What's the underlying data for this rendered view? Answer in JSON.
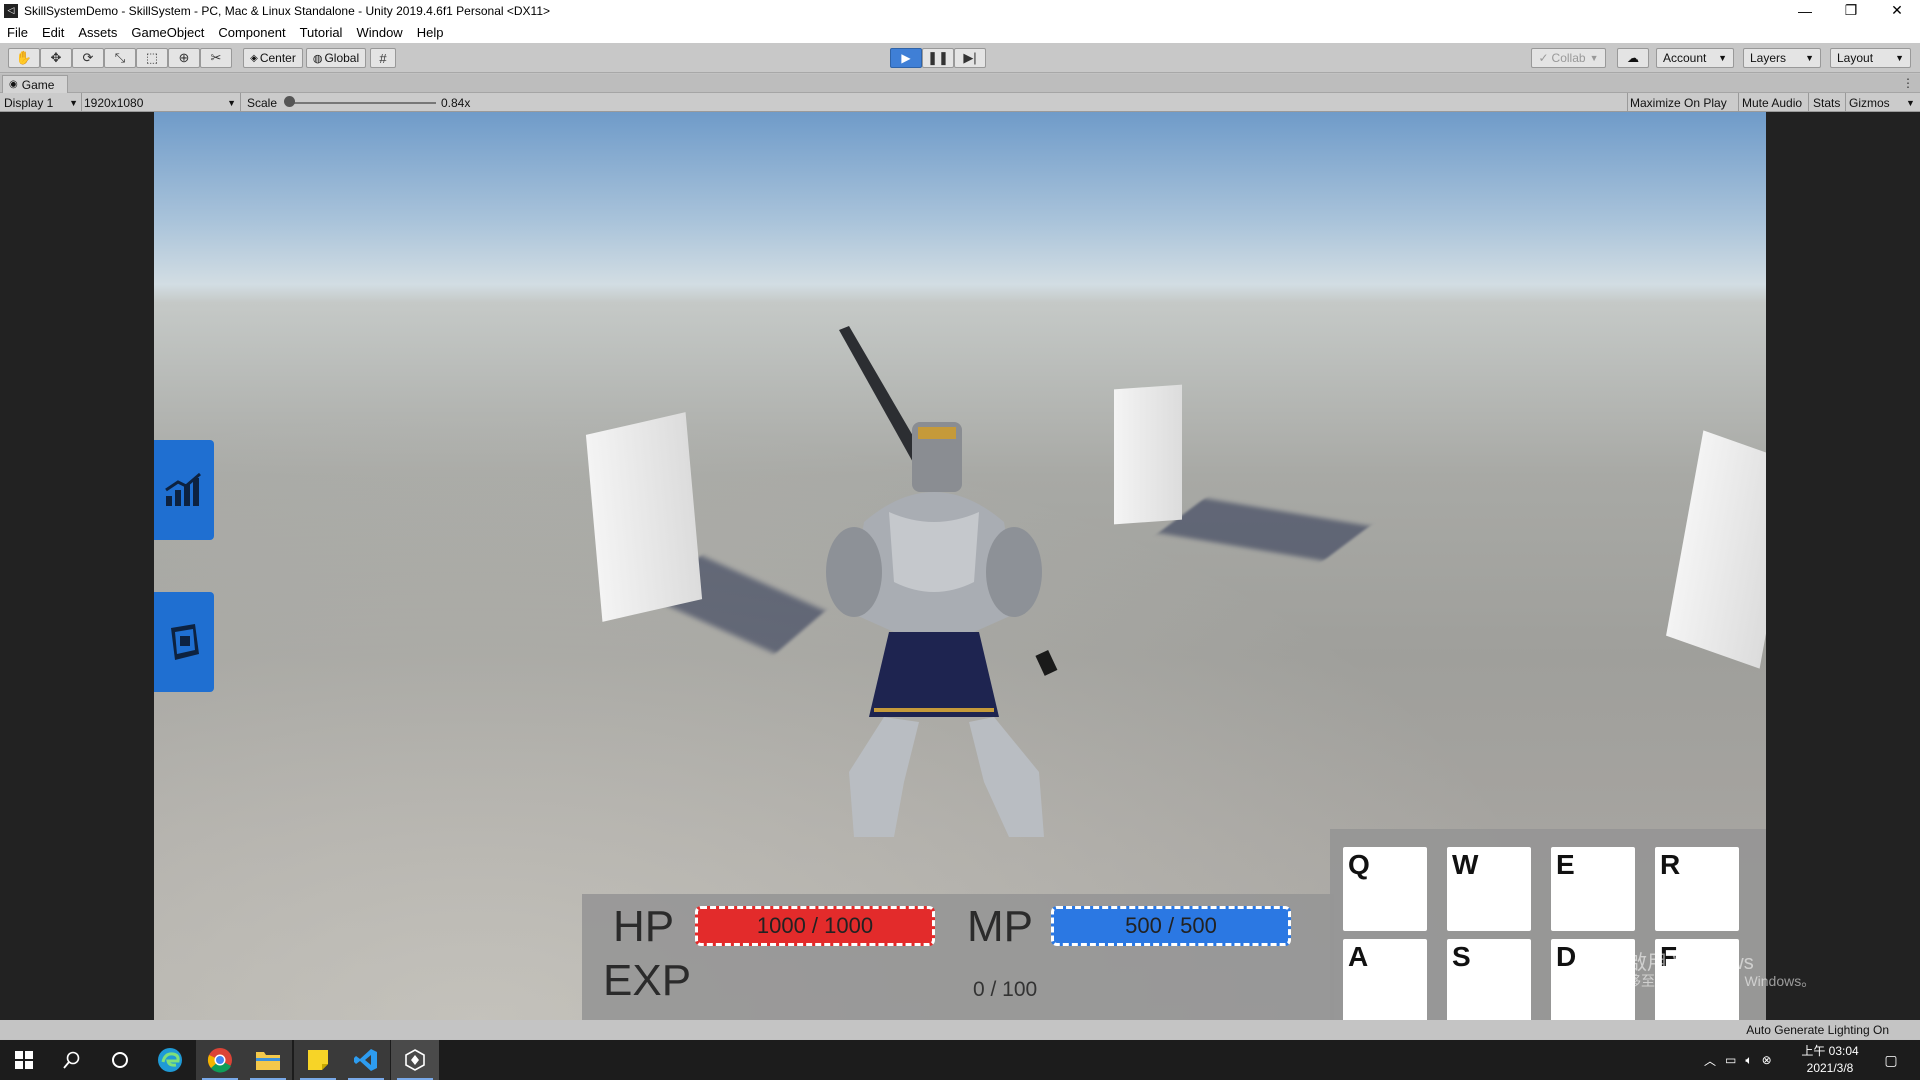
{
  "window": {
    "title": "SkillSystemDemo - SkillSystem - PC, Mac & Linux Standalone - Unity 2019.4.6f1 Personal <DX11>",
    "minimize": "—",
    "restore": "❐",
    "close": "✕"
  },
  "menu": [
    "File",
    "Edit",
    "Assets",
    "GameObject",
    "Component",
    "Tutorial",
    "Window",
    "Help"
  ],
  "toolbar": {
    "tools": [
      "hand-icon",
      "move-icon",
      "rotate-icon",
      "scale-icon",
      "rect-icon",
      "transform-icon",
      "custom-tool-icon"
    ],
    "pivot_label": "Center",
    "space_label": "Global",
    "collab_label": "Collab",
    "account_label": "Account",
    "layers_label": "Layers",
    "layout_label": "Layout",
    "playing": true
  },
  "tab": {
    "label": "Game"
  },
  "gameview": {
    "display": "Display 1",
    "resolution": "1920x1080",
    "scale_label": "Scale",
    "scale_value": "0.84x",
    "scale_fraction": 0.05,
    "maximize": "Maximize On Play",
    "mute": "Mute Audio",
    "stats": "Stats",
    "gizmos": "Gizmos"
  },
  "hud": {
    "hp_label": "HP",
    "hp_text": "1000 / 1000",
    "hp_fraction": 1.0,
    "mp_label": "MP",
    "mp_text": "500 / 500",
    "mp_fraction": 1.0,
    "exp_label": "EXP",
    "exp_text": "0 / 100",
    "side_buttons": [
      "stats-chart-icon",
      "skill-book-icon"
    ],
    "colors": {
      "hp": "#e32b2b",
      "mp": "#2b78e3",
      "side": "#1f6fd1"
    }
  },
  "skills": [
    "Q",
    "W",
    "E",
    "R",
    "A",
    "S",
    "D",
    "F"
  ],
  "watermark": {
    "line1": "啟用 Windows",
    "line2": "移至 [設定] 以啟用 Windows。"
  },
  "status": {
    "text": "Auto Generate Lighting On"
  },
  "taskbar": {
    "apps": [
      "start-icon",
      "search-icon",
      "cortana-icon",
      "edge-icon",
      "chrome-icon",
      "file-explorer-icon",
      "sticky-notes-icon",
      "vscode-icon",
      "unity-icon"
    ],
    "clock_time": "上午 03:04",
    "clock_date": "2021/3/8"
  }
}
